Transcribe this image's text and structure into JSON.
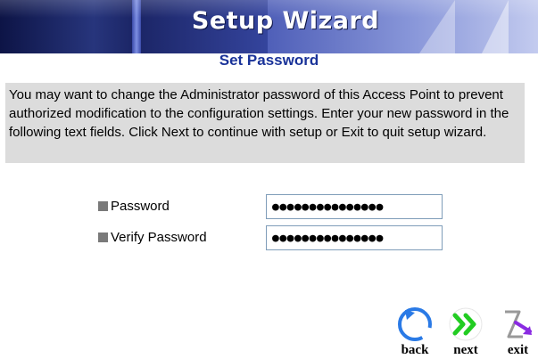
{
  "banner": {
    "title": "Setup Wizard"
  },
  "page": {
    "subtitle": "Set Password",
    "description": "You may want to change the Administrator password of this Access Point to prevent authorized modification to the configuration settings. Enter your new password in the following text fields. Click Next to continue with setup or Exit to quit setup wizard."
  },
  "form": {
    "password": {
      "label": "Password",
      "value": "●●●●●●●●●●●●●●●"
    },
    "verify_password": {
      "label": "Verify Password",
      "value": "●●●●●●●●●●●●●●●"
    }
  },
  "nav": {
    "back": {
      "label": "back",
      "icon": "refresh-circle-icon"
    },
    "next": {
      "label": "next",
      "icon": "double-chevron-right-icon"
    },
    "exit": {
      "label": "exit",
      "icon": "exit-arrow-icon"
    }
  },
  "colors": {
    "subtitle": "#1a3399",
    "description_bg": "#dcdcdc",
    "bullet": "#7a7a7a",
    "back_icon": "#2a7ae6",
    "next_icon": "#22cc22",
    "exit_icon": "#8a2be2"
  }
}
